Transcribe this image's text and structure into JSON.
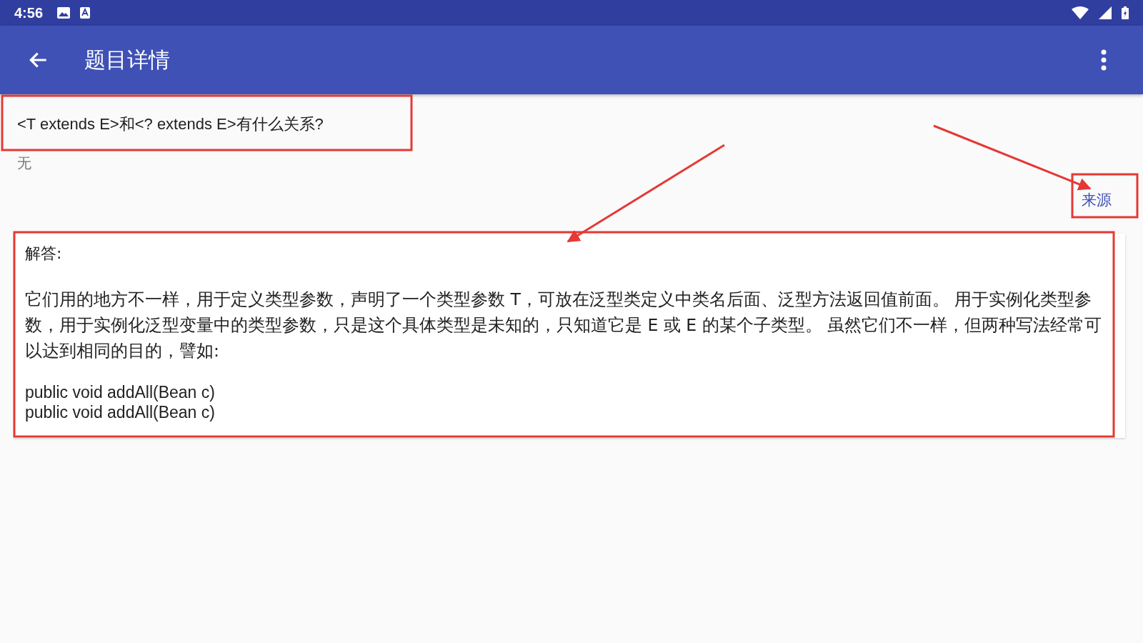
{
  "status_bar": {
    "time": "4:56"
  },
  "app_bar": {
    "title": "题目详情"
  },
  "question": {
    "title": "<T extends E>和<? extends E>有什么关系?",
    "note": "无",
    "source_link": "来源"
  },
  "answer": {
    "heading": "解答:",
    "paragraph": "它们用的地方不一样，用于定义类型参数，声明了一个类型参数 T，可放在泛型类定义中类名后面、泛型方法返回值前面。 用于实例化类型参数，用于实例化泛型变量中的类型参数，只是这个具体类型是未知的，只知道它是 E 或 E 的某个子类型。 虽然它们不一样，但两种写法经常可以达到相同的目的，譬如:",
    "code_lines": [
      "public void addAll(Bean c)",
      "public void addAll(Bean c)"
    ]
  }
}
